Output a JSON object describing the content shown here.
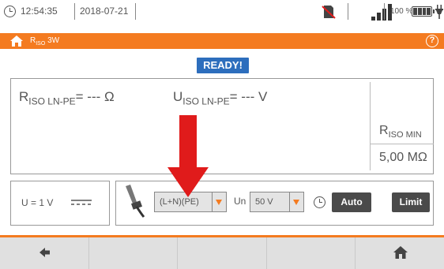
{
  "status_bar": {
    "time": "12:54:35",
    "date": "2018-07-21",
    "battery_percent": "100 %",
    "icons": [
      "clock-icon",
      "sd-card-crossed-icon",
      "signal-bars-icon",
      "battery-icon",
      "plug-icon"
    ]
  },
  "header": {
    "title_main": "R",
    "title_sub": "ISO",
    "title_suffix": " 3W",
    "accent_color": "#f47b20"
  },
  "status_badge": "READY!",
  "results": {
    "r_symbol": "R",
    "r_sub": "ISO LN-PE",
    "r_value": "= --- Ω",
    "u_symbol": "U",
    "u_sub": "ISO LN-PE",
    "u_value": "= --- V",
    "rmin_symbol": "R",
    "rmin_sub": "ISO MIN",
    "rmin_value": "5,00 MΩ"
  },
  "settings": {
    "voltage_label": "U = 1 V",
    "config_value": "(L+N)(PE)",
    "un_label": "Un",
    "un_value": "50 V",
    "auto_label": "Auto",
    "limit_label": "Limit"
  },
  "colors": {
    "ready_bg": "#2d6ebd",
    "arrow": "#e01b1b",
    "nav_bg": "#e0e0e0"
  }
}
